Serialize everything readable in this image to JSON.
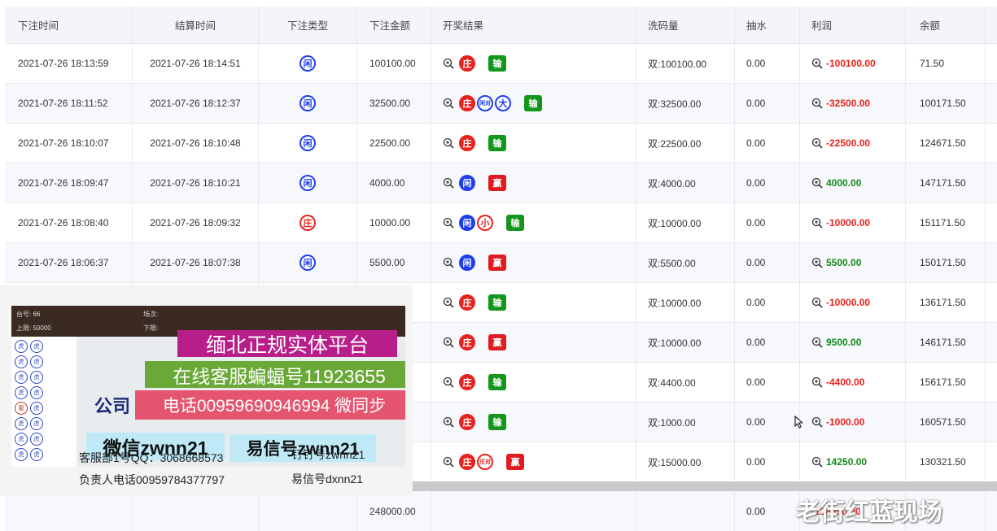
{
  "columns": [
    "下注时间",
    "结算时间",
    "下注类型",
    "下注金额",
    "开奖结果",
    "洗码量",
    "抽水",
    "利润",
    "余额"
  ],
  "rows": [
    {
      "bet_time": "2021-07-26 18:13:59",
      "settle_time": "2021-07-26 18:14:51",
      "type": "闲",
      "type_color": "blue",
      "amount": "100100.00",
      "results": [
        {
          "t": "庄",
          "s": "fill-red"
        }
      ],
      "outcome": "输",
      "outcome_kind": "lose",
      "wash": "双:100100.00",
      "commission": "0.00",
      "profit": "-100100.00",
      "profit_sign": "neg",
      "balance": "71.50"
    },
    {
      "bet_time": "2021-07-26 18:11:52",
      "settle_time": "2021-07-26 18:12:37",
      "type": "闲",
      "type_color": "blue",
      "amount": "32500.00",
      "results": [
        {
          "t": "庄",
          "s": "fill-red"
        },
        {
          "t": "闲对",
          "s": "blue small"
        },
        {
          "t": "大",
          "s": "blue"
        }
      ],
      "outcome": "输",
      "outcome_kind": "lose",
      "wash": "双:32500.00",
      "commission": "0.00",
      "profit": "-32500.00",
      "profit_sign": "neg",
      "balance": "100171.50"
    },
    {
      "bet_time": "2021-07-26 18:10:07",
      "settle_time": "2021-07-26 18:10:48",
      "type": "闲",
      "type_color": "blue",
      "amount": "22500.00",
      "results": [
        {
          "t": "庄",
          "s": "fill-red"
        }
      ],
      "outcome": "输",
      "outcome_kind": "lose",
      "wash": "双:22500.00",
      "commission": "0.00",
      "profit": "-22500.00",
      "profit_sign": "neg",
      "balance": "124671.50"
    },
    {
      "bet_time": "2021-07-26 18:09:47",
      "settle_time": "2021-07-26 18:10:21",
      "type": "闲",
      "type_color": "blue",
      "amount": "4000.00",
      "results": [
        {
          "t": "闲",
          "s": "fill-blue"
        }
      ],
      "outcome": "赢",
      "outcome_kind": "win",
      "wash": "双:4000.00",
      "commission": "0.00",
      "profit": "4000.00",
      "profit_sign": "pos",
      "balance": "147171.50"
    },
    {
      "bet_time": "2021-07-26 18:08:40",
      "settle_time": "2021-07-26 18:09:32",
      "type": "庄",
      "type_color": "red",
      "amount": "10000.00",
      "results": [
        {
          "t": "闲",
          "s": "fill-blue"
        },
        {
          "t": "小",
          "s": "red"
        }
      ],
      "outcome": "输",
      "outcome_kind": "lose",
      "wash": "双:10000.00",
      "commission": "0.00",
      "profit": "-10000.00",
      "profit_sign": "neg",
      "balance": "151171.50"
    },
    {
      "bet_time": "2021-07-26 18:06:37",
      "settle_time": "2021-07-26 18:07:38",
      "type": "闲",
      "type_color": "blue",
      "amount": "5500.00",
      "results": [
        {
          "t": "闲",
          "s": "fill-blue"
        }
      ],
      "outcome": "赢",
      "outcome_kind": "win",
      "wash": "双:5500.00",
      "commission": "0.00",
      "profit": "5500.00",
      "profit_sign": "pos",
      "balance": "150171.50"
    },
    {
      "bet_time": "",
      "settle_time": "",
      "type": "",
      "type_color": "blue",
      "amount": "",
      "results": [
        {
          "t": "庄",
          "s": "fill-red"
        }
      ],
      "outcome": "输",
      "outcome_kind": "lose",
      "wash": "双:10000.00",
      "commission": "0.00",
      "profit": "-10000.00",
      "profit_sign": "neg",
      "balance": "136171.50"
    },
    {
      "bet_time": "",
      "settle_time": "",
      "type": "",
      "type_color": "blue",
      "amount": "",
      "results": [
        {
          "t": "庄",
          "s": "fill-red"
        }
      ],
      "outcome": "赢",
      "outcome_kind": "win",
      "wash": "双:10000.00",
      "commission": "0.00",
      "profit": "9500.00",
      "profit_sign": "pos",
      "balance": "146171.50"
    },
    {
      "bet_time": "",
      "settle_time": "",
      "type": "",
      "type_color": "blue",
      "amount": "",
      "results": [
        {
          "t": "庄",
          "s": "fill-red"
        }
      ],
      "outcome": "输",
      "outcome_kind": "lose",
      "wash": "双:4400.00",
      "commission": "0.00",
      "profit": "-4400.00",
      "profit_sign": "neg",
      "balance": "156171.50"
    },
    {
      "bet_time": "",
      "settle_time": "",
      "type": "",
      "type_color": "blue",
      "amount": "",
      "results": [
        {
          "t": "庄",
          "s": "fill-red"
        }
      ],
      "outcome": "输",
      "outcome_kind": "lose",
      "wash": "双:1000.00",
      "commission": "0.00",
      "profit": "-1000.00",
      "profit_sign": "neg",
      "balance": "160571.50"
    },
    {
      "bet_time": "",
      "settle_time": "",
      "type": "",
      "type_color": "blue",
      "amount": "",
      "results": [
        {
          "t": "庄",
          "s": "fill-red"
        },
        {
          "t": "庄对",
          "s": "red small"
        }
      ],
      "outcome": "赢",
      "outcome_kind": "win",
      "wash": "双:15000.00",
      "commission": "0.00",
      "profit": "14250.00",
      "profit_sign": "pos",
      "balance": "130321.50"
    }
  ],
  "footer": {
    "amount_total": "248000.00",
    "commission_total": "0.00",
    "profit_total": "-138050.00"
  },
  "overlay": {
    "table_no_label": "台号:",
    "table_no": "66",
    "limit_label": "上限:",
    "limit": "50000",
    "round_label": "场次:",
    "lower_label": "下限:",
    "banner1": "缅北正规实体平台",
    "banner2": "在线客服蝙蝠号11923655",
    "banner3": "公司",
    "banner4": "电话00959690946994 微同步",
    "banner5": "微信zwnn21",
    "banner6": "易信号zwnn21",
    "contact1": "客服部1号QQ：3068668573",
    "contact2": "钉钉号zwnn21",
    "contact3": "负责人电话00959784377797",
    "contact4": "易信号dxnn21",
    "road_symbol": "虎",
    "road_symbol_alt": "龍"
  },
  "watermark": "老街红蓝现场",
  "colors": {
    "lose": "#13961c",
    "win": "#e01c21",
    "banker": "#e8231e",
    "player": "#1f3ef0"
  }
}
